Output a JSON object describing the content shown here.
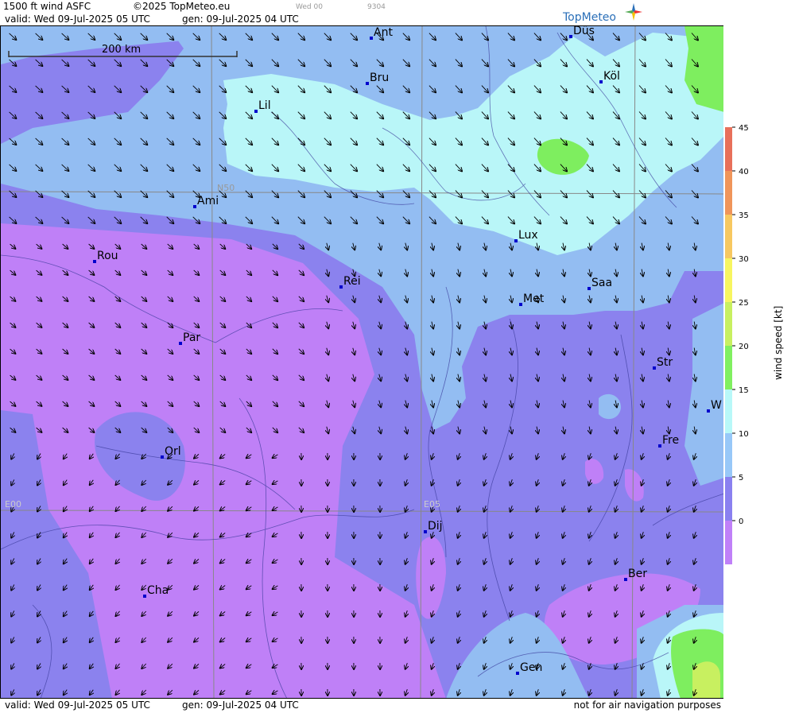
{
  "header": {
    "title": "1500 ft wind ASFC",
    "copyright": "©2025 TopMeteo.eu",
    "run_small": "Wed 00",
    "code_small": "9304",
    "valid": "valid:  Wed  09-Jul-2025  05 UTC",
    "gen": "gen:  09-Jul-2025 04 UTC",
    "brand": "TopMeteo"
  },
  "footer": {
    "valid": "valid:  Wed  09-Jul-2025  05 UTC",
    "gen": "gen:  09-Jul-2025 04 UTC",
    "disclaimer": "not for air navigation purposes"
  },
  "scale_label": "200 km",
  "grid_labels": {
    "lat": "N50",
    "lon1": "E00",
    "lon2": "E05"
  },
  "cities": [
    {
      "name": "Ant"
    },
    {
      "name": "Düs"
    },
    {
      "name": "Bru"
    },
    {
      "name": "Köl"
    },
    {
      "name": "Lil"
    },
    {
      "name": "Ami"
    },
    {
      "name": "Lux"
    },
    {
      "name": "Rou"
    },
    {
      "name": "Rei"
    },
    {
      "name": "Saa"
    },
    {
      "name": "Met"
    },
    {
      "name": "Par"
    },
    {
      "name": "Str"
    },
    {
      "name": "W"
    },
    {
      "name": "Fre"
    },
    {
      "name": "Orl"
    },
    {
      "name": "Dij"
    },
    {
      "name": "Ber"
    },
    {
      "name": "Cha"
    },
    {
      "name": "Gen"
    }
  ],
  "legend": {
    "label": "wind  speed  [kt]",
    "ticks": [
      "45",
      "40",
      "35",
      "30",
      "25",
      "20",
      "15",
      "10",
      "5",
      "0"
    ],
    "colors": [
      "#e8705a",
      "#f0955a",
      "#f7c860",
      "#f7f560",
      "#c8f060",
      "#80f060",
      "#b8f8f8",
      "#98c8f8",
      "#8a80f0",
      "#c080f8"
    ]
  },
  "colors": {
    "calm": "#bf80f7",
    "light": "#8b82ee",
    "moderate": "#93bdf2",
    "fresh": "#b9f6f8",
    "strong": "#7eee5f"
  }
}
